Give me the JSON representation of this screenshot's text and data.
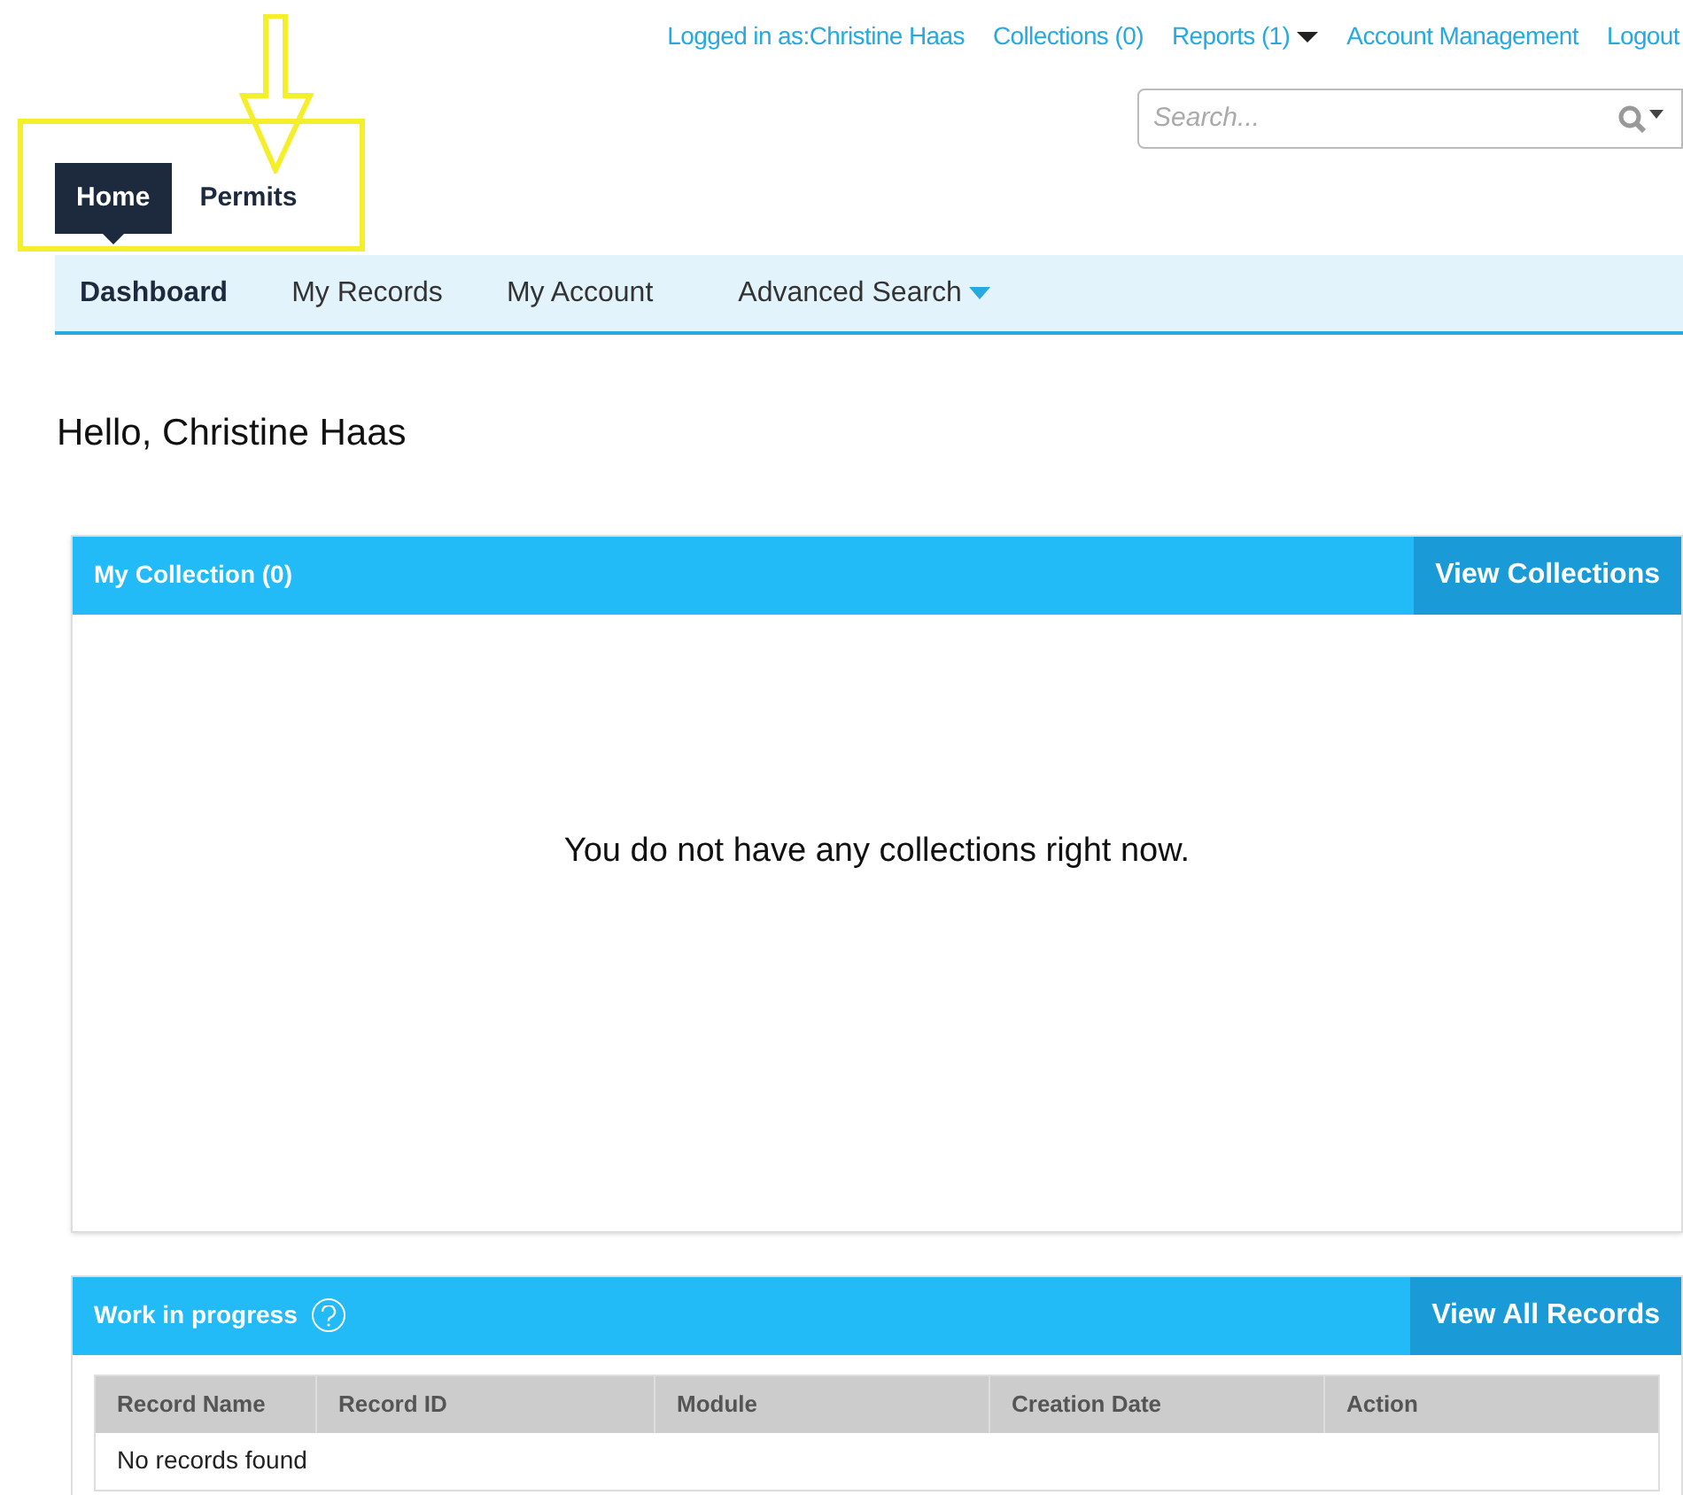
{
  "top_links": [
    {
      "label": "Logged in as:Christine Haas",
      "dropdown": false
    },
    {
      "label": "Collections (0)",
      "dropdown": false
    },
    {
      "label": "Reports (1)",
      "dropdown": true
    },
    {
      "label": "Account Management",
      "dropdown": false
    },
    {
      "label": "Logout",
      "dropdown": false
    }
  ],
  "search": {
    "placeholder": "Search..."
  },
  "tabs": [
    {
      "label": "Home",
      "selected": true
    },
    {
      "label": "Permits",
      "selected": false
    }
  ],
  "sub_nav": [
    {
      "label": "Dashboard",
      "selected": true,
      "dropdown": false
    },
    {
      "label": "My Records",
      "selected": false,
      "dropdown": false
    },
    {
      "label": "My Account",
      "selected": false,
      "dropdown": false
    },
    {
      "label": "Advanced Search",
      "selected": false,
      "dropdown": true
    }
  ],
  "greeting": "Hello, Christine Haas",
  "collection_panel": {
    "title": "My Collection (0)",
    "button": "View Collections",
    "message": "You do not have any collections right now."
  },
  "work_panel": {
    "title": "Work in progress",
    "button": "View All Records",
    "table": {
      "columns": [
        "Record Name",
        "Record ID",
        "Module",
        "Creation Date",
        "Action"
      ],
      "empty_message": "No records found"
    }
  }
}
